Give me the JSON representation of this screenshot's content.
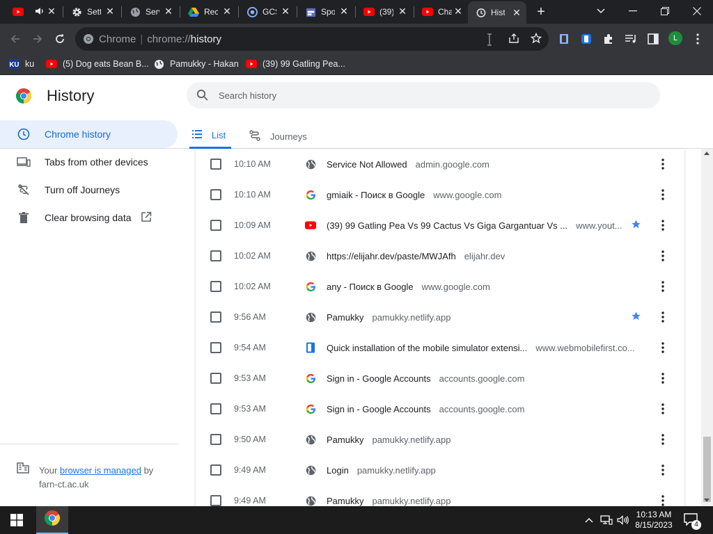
{
  "tabs": [
    {
      "title": "",
      "icon": "youtube-icon",
      "audio": true
    },
    {
      "title": "Settings",
      "icon": "gear-icon"
    },
    {
      "title": "Service",
      "icon": "globe-icon"
    },
    {
      "title": "Recent",
      "icon": "google-drive-icon"
    },
    {
      "title": "GCSE",
      "icon": "chrome-ext-icon"
    },
    {
      "title": "Spot",
      "icon": "calendar-icon"
    },
    {
      "title": "(39)",
      "icon": "youtube-icon"
    },
    {
      "title": "Cha",
      "icon": "youtube-icon"
    },
    {
      "title": "History",
      "icon": "history-icon",
      "active": true
    }
  ],
  "omnibox": {
    "scheme_label": "Chrome",
    "url_prefix": "chrome://",
    "url_host": "history"
  },
  "profile_initial": "L",
  "bookmarks": [
    {
      "label": "ku",
      "icon": "ku-icon"
    },
    {
      "label": "(5) Dog eats Bean B...",
      "icon": "youtube-icon"
    },
    {
      "label": "Pamukky - Hakan",
      "icon": "globe-icon"
    },
    {
      "label": "(39) 99 Gatling Pea...",
      "icon": "youtube-icon"
    }
  ],
  "page": {
    "title": "History",
    "search_placeholder": "Search history"
  },
  "view_tabs": {
    "list": "List",
    "journeys": "Journeys"
  },
  "sidebar": {
    "items": [
      {
        "label": "Chrome history",
        "icon": "clock-icon"
      },
      {
        "label": "Tabs from other devices",
        "icon": "devices-icon"
      },
      {
        "label": "Turn off Journeys",
        "icon": "journeys-off-icon"
      },
      {
        "label": "Clear browsing data",
        "icon": "trash-icon"
      }
    ],
    "managed_prefix": "Your ",
    "managed_link": "browser is managed",
    "managed_suffix": " by",
    "managed_org": "farn-ct.ac.uk"
  },
  "history": [
    {
      "time": "10:10 AM",
      "title": "Service Not Allowed",
      "domain": "admin.google.com",
      "icon": "globe",
      "starred": false
    },
    {
      "time": "10:10 AM",
      "title": "gmiaik - Поиск в Google",
      "domain": "www.google.com",
      "icon": "google",
      "starred": false
    },
    {
      "time": "10:09 AM",
      "title": "(39) 99 Gatling Pea Vs 99 Cactus Vs Giga Gargantuar Vs ...",
      "domain": "www.yout...",
      "icon": "youtube",
      "starred": true
    },
    {
      "time": "10:02 AM",
      "title": "https://elijahr.dev/paste/MWJAfh",
      "domain": "elijahr.dev",
      "icon": "globe",
      "starred": false
    },
    {
      "time": "10:02 AM",
      "title": "any - Поиск в Google",
      "domain": "www.google.com",
      "icon": "google",
      "starred": false
    },
    {
      "time": "9:56 AM",
      "title": "Pamukky",
      "domain": "pamukky.netlify.app",
      "icon": "globe",
      "starred": true
    },
    {
      "time": "9:54 AM",
      "title": "Quick installation of the mobile simulator extensi...",
      "domain": "www.webmobilefirst.co...",
      "icon": "mobile",
      "starred": false
    },
    {
      "time": "9:53 AM",
      "title": "Sign in - Google Accounts",
      "domain": "accounts.google.com",
      "icon": "google",
      "starred": false
    },
    {
      "time": "9:53 AM",
      "title": "Sign in - Google Accounts",
      "domain": "accounts.google.com",
      "icon": "google",
      "starred": false
    },
    {
      "time": "9:50 AM",
      "title": "Pamukky",
      "domain": "pamukky.netlify.app",
      "icon": "globe",
      "starred": false
    },
    {
      "time": "9:49 AM",
      "title": "Login",
      "domain": "pamukky.netlify.app",
      "icon": "globe",
      "starred": false
    },
    {
      "time": "9:49 AM",
      "title": "Pamukky",
      "domain": "pamukky.netlify.app",
      "icon": "globe",
      "starred": false
    }
  ],
  "taskbar": {
    "time": "10:13 AM",
    "date": "8/15/2023",
    "notifications": "4"
  },
  "colors": {
    "accent": "#1a73e8",
    "selected_nav_bg": "#e8f0fe",
    "dark_chrome": "#202124",
    "toolbar": "#35363a",
    "youtube_red": "#ff0000",
    "star_blue": "#4285f4"
  }
}
